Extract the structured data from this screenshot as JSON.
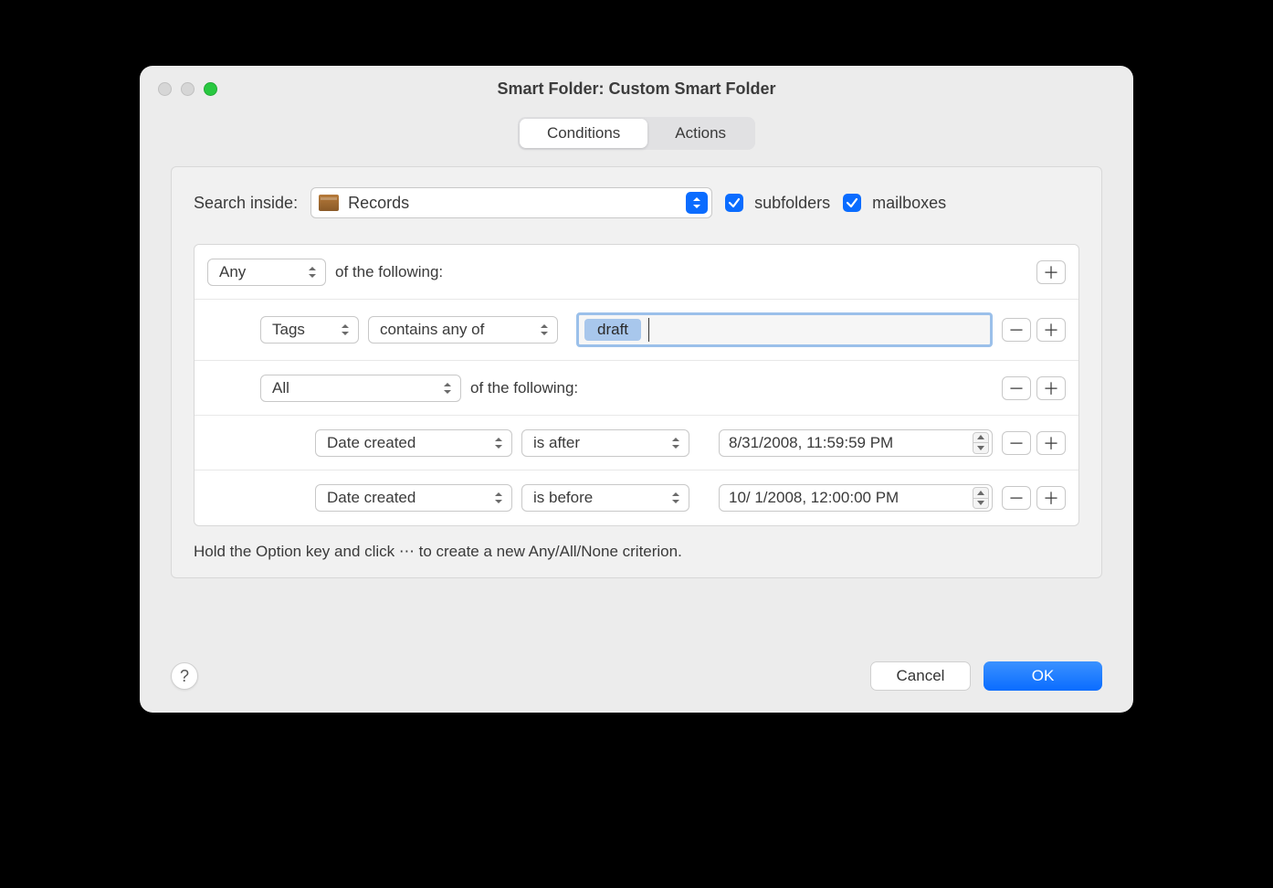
{
  "window": {
    "title": "Smart Folder: Custom Smart Folder"
  },
  "tabs": {
    "conditions": "Conditions",
    "actions": "Actions"
  },
  "search": {
    "label": "Search inside:",
    "folder": "Records",
    "subfolders_label": "subfolders",
    "mailboxes_label": "mailboxes"
  },
  "rules": {
    "of_following": "of the following:",
    "row0": {
      "match": "Any"
    },
    "row1": {
      "attr": "Tags",
      "op": "contains any of",
      "tag": "draft"
    },
    "row2": {
      "match": "All"
    },
    "row3": {
      "attr": "Date created",
      "op": "is after",
      "value": "8/31/2008, 11:59:59 PM"
    },
    "row4": {
      "attr": "Date created",
      "op": "is before",
      "value": "10/  1/2008, 12:00:00 PM"
    }
  },
  "hint": "Hold the Option key and click ⋯ to create a new Any/All/None criterion.",
  "footer": {
    "help": "?",
    "cancel": "Cancel",
    "ok": "OK"
  }
}
